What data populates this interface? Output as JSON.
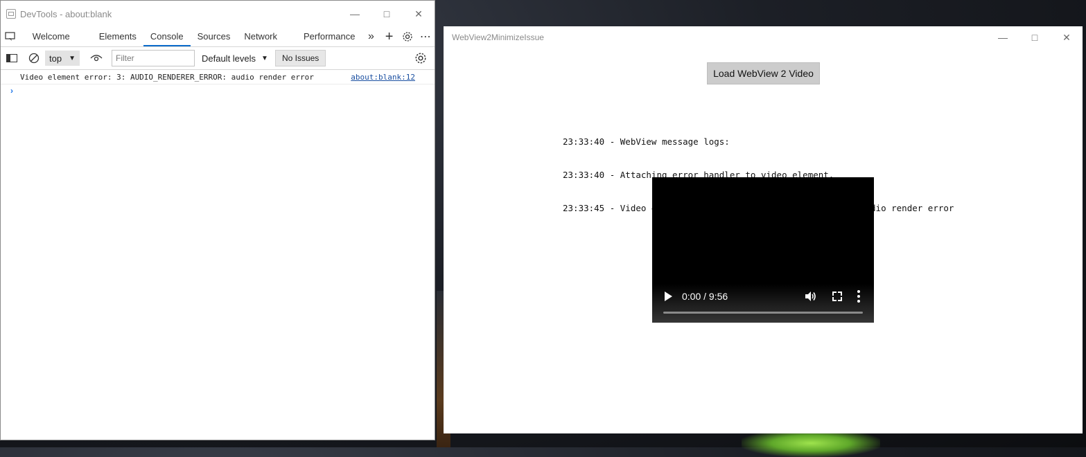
{
  "devtools": {
    "title": "DevTools - about:blank",
    "tabs": [
      "Welcome",
      "Elements",
      "Console",
      "Sources",
      "Network",
      "Performance"
    ],
    "active_tab": "Console",
    "context": "top",
    "filter_placeholder": "Filter",
    "levels_label": "Default levels",
    "issues_label": "No Issues",
    "console": {
      "message": "Video element error: 3: AUDIO_RENDERER_ERROR: audio render error",
      "source": "about:blank:12",
      "prompt": "›"
    }
  },
  "app": {
    "title": "WebView2MinimizeIssue",
    "load_button": "Load WebView 2 Video",
    "logs": [
      "23:33:40 - WebView message logs:",
      "23:33:40 - Attaching error handler to video element.",
      "23:33:45 - Video element error: 3: AUDIO_RENDERER_ERROR: audio render error"
    ],
    "video": {
      "time": "0:00 / 9:56",
      "progress": 0
    }
  },
  "colors": {
    "accent": "#0b6bcb",
    "link": "#1a4fa1"
  }
}
